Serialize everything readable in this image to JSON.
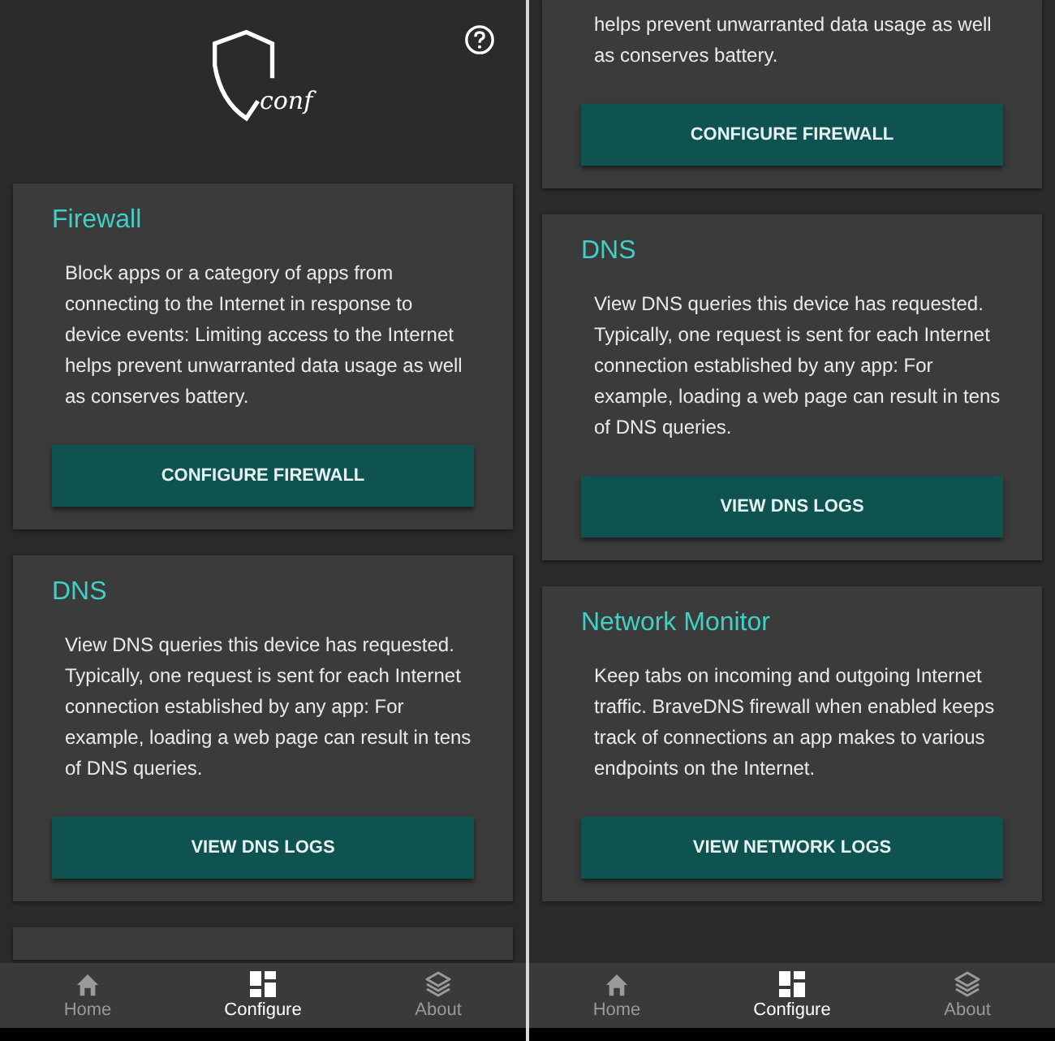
{
  "screens": [
    {
      "header": {
        "logo_text": "conf",
        "help": true
      },
      "cards": [
        {
          "kind": "full",
          "title": "Firewall",
          "description": "Block apps or a category of apps from connecting to the Internet in response to device events: Limiting access to the Internet helps prevent unwarranted data usage as well as conserves battery.",
          "button": "CONFIGURE FIREWALL"
        },
        {
          "kind": "full",
          "title": "DNS",
          "description": "View DNS queries this device has requested. Typically, one request is sent for each Internet connection established by any app: For example, loading a web page can result in tens of DNS queries.",
          "button": "VIEW DNS LOGS"
        },
        {
          "kind": "cut_bottom"
        }
      ],
      "nav": [
        {
          "kind": "home",
          "label": "Home",
          "selected": false
        },
        {
          "kind": "configure",
          "label": "Configure",
          "selected": true
        },
        {
          "kind": "about",
          "label": "About",
          "selected": false
        }
      ]
    },
    {
      "cards": [
        {
          "kind": "cut_top",
          "description": "helps prevent unwarranted data usage as well as conserves battery.",
          "button": "CONFIGURE FIREWALL"
        },
        {
          "kind": "full",
          "title": "DNS",
          "description": "View DNS queries this device has requested. Typically, one request is sent for each Internet connection established by any app: For example, loading a web page can result in tens of DNS queries.",
          "button": "VIEW DNS LOGS"
        },
        {
          "kind": "full",
          "title": "Network Monitor",
          "description": "Keep tabs on incoming and outgoing Internet traffic. BraveDNS firewall when enabled keeps track of connections an app makes to various endpoints on the Internet.",
          "button": "VIEW NETWORK LOGS"
        }
      ],
      "nav": [
        {
          "kind": "home",
          "label": "Home",
          "selected": false
        },
        {
          "kind": "configure",
          "label": "Configure",
          "selected": true
        },
        {
          "kind": "about",
          "label": "About",
          "selected": false
        }
      ]
    }
  ]
}
